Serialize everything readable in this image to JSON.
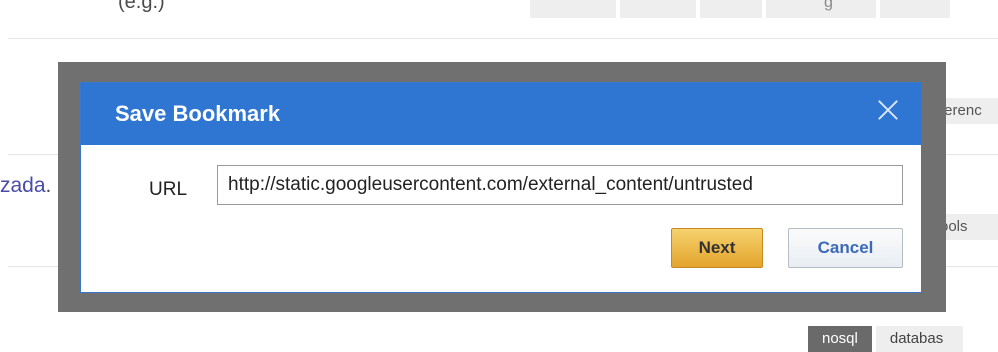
{
  "background": {
    "top_left_text": "(e.g.)",
    "top_tag_glyph": "g",
    "link_fragment": "zada",
    "link_dot": ".",
    "right_tags": [
      "ferenc",
      "ools"
    ],
    "bottom_tags": [
      "nosql",
      "databas"
    ]
  },
  "dialog": {
    "title": "Save Bookmark",
    "url_label": "URL",
    "url_value": "http://static.googleusercontent.com/external_content/untrusted",
    "next_label": "Next",
    "cancel_label": "Cancel"
  },
  "colors": {
    "header_blue": "#2f75d2",
    "overlay_gray": "#707070",
    "next_gold": "#e3a42c",
    "cancel_text": "#3b6ab8"
  },
  "icons": {
    "close": "close-icon"
  }
}
